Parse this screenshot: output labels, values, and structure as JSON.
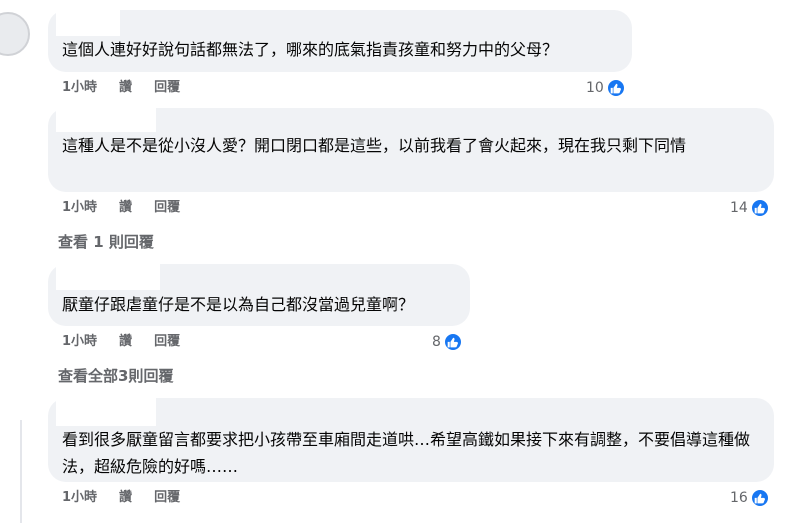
{
  "comments": [
    {
      "text": "這個人連好好說句話都無法了，哪來的底氣指責孩童和努力中的父母？",
      "time": "1小時",
      "like_label": "讚",
      "reply_label": "回覆",
      "reaction_count": "10"
    },
    {
      "text": "這種人是不是從小沒人愛？開口閉口都是這些，以前我看了會火起來，現在我只剩下同情",
      "time": "1小時",
      "like_label": "讚",
      "reply_label": "回覆",
      "reaction_count": "14",
      "view_replies": "查看 1 則回覆"
    },
    {
      "text": "厭童仔跟虐童仔是不是以為自己都沒當過兒童啊？",
      "time": "1小時",
      "like_label": "讚",
      "reply_label": "回覆",
      "reaction_count": "8",
      "view_replies": "查看全部3則回覆"
    },
    {
      "text": "看到很多厭童留言都要求把小孩帶至車廂間走道哄…希望高鐵如果接下來有調整，不要倡導這種做法，超級危險的好嗎……",
      "time": "1小時",
      "like_label": "讚",
      "reply_label": "回覆",
      "reaction_count": "16"
    }
  ],
  "icons": {
    "reaction": "like-thumbs-up-icon"
  },
  "colors": {
    "bubble": "#f0f2f5",
    "meta": "#65676b",
    "like_blue": "#1877f2"
  }
}
